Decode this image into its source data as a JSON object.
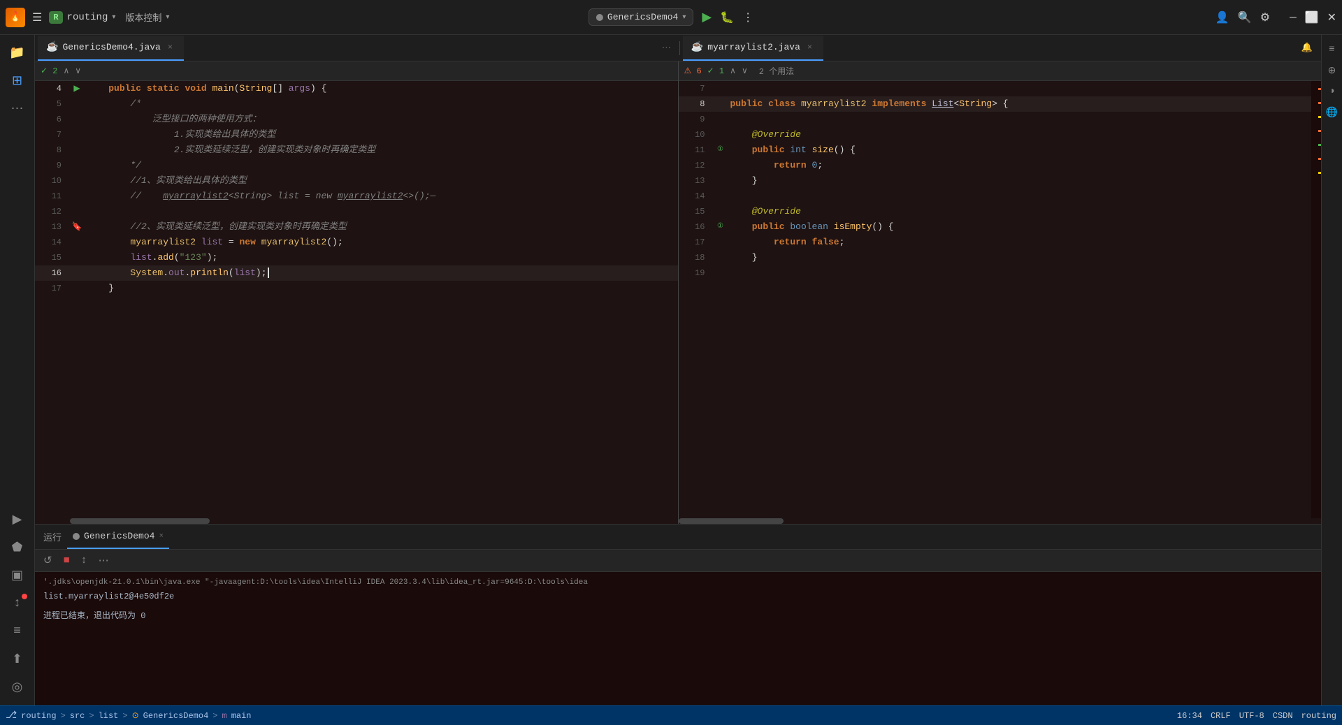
{
  "titleBar": {
    "projectLetter": "R",
    "projectName": "routing",
    "dropdownLabel": "▾",
    "versionControl": "版本控制",
    "versionControlArrow": "▾",
    "runConfig": "GenericsDemo4",
    "runConfigArrow": "▾"
  },
  "tabs": {
    "left": {
      "icon": "☕",
      "label": "GenericsDemo4.java",
      "closeBtn": "×",
      "moreBtn": "⋯"
    },
    "right": {
      "icon": "☕",
      "label": "myarraylist2.java",
      "closeBtn": "×",
      "notificationBtn": "🔔"
    }
  },
  "editorLeft": {
    "checkCount": "✓ 2",
    "navUp": "∧",
    "navDown": "∨",
    "lines": [
      {
        "num": "4",
        "gutter": "▶",
        "gutterType": "run",
        "content": "    public static void main(String[] args) {"
      },
      {
        "num": "5",
        "gutter": "",
        "content": "        /*"
      },
      {
        "num": "6",
        "gutter": "",
        "content": "            泛型接口的两种使用方式："
      },
      {
        "num": "7",
        "gutter": "",
        "content": "                1.实现类给出具体的类型"
      },
      {
        "num": "8",
        "gutter": "",
        "content": "                2.实现类延续泛型，创建实现类对象时再确定类型"
      },
      {
        "num": "9",
        "gutter": "",
        "content": "        */"
      },
      {
        "num": "10",
        "gutter": "",
        "content": "        //1、实现类给出具体的类型"
      },
      {
        "num": "11",
        "gutter": "",
        "content": "        //    myarraylist2<String> list = new myarraylist2<>();—"
      },
      {
        "num": "12",
        "gutter": "",
        "content": ""
      },
      {
        "num": "13",
        "gutter": "🔖",
        "gutterType": "bookmark",
        "content": "        //2、实现类延续泛型，创建实现类对象时再确定类型"
      },
      {
        "num": "14",
        "gutter": "",
        "content": "        myarraylist2 list = new myarraylist2();"
      },
      {
        "num": "15",
        "gutter": "",
        "content": "        list.add(\"123\");"
      },
      {
        "num": "16",
        "gutter": "",
        "content": "        System.out.println(list);",
        "active": true
      },
      {
        "num": "17",
        "gutter": "",
        "content": "    }"
      }
    ]
  },
  "editorRight": {
    "errorCount": "⚠ 6",
    "checkCount": "✓ 1",
    "navUp": "∧",
    "navDown": "∨",
    "usageHint": "2 个用法",
    "lines": [
      {
        "num": "7",
        "gutter": "",
        "content": ""
      },
      {
        "num": "8",
        "gutter": "",
        "content": "public class myarraylist2 implements List<String> {",
        "active": true
      },
      {
        "num": "9",
        "gutter": "",
        "content": ""
      },
      {
        "num": "10",
        "gutter": "",
        "content": "    @Override"
      },
      {
        "num": "11",
        "gutter": "①",
        "gutterType": "impl",
        "content": "    public int size() {"
      },
      {
        "num": "12",
        "gutter": "",
        "content": "        return 0;"
      },
      {
        "num": "13",
        "gutter": "",
        "content": "    }"
      },
      {
        "num": "14",
        "gutter": "",
        "content": ""
      },
      {
        "num": "15",
        "gutter": "",
        "content": "    @Override"
      },
      {
        "num": "16",
        "gutter": "①",
        "gutterType": "impl",
        "content": "    public boolean isEmpty() {"
      },
      {
        "num": "17",
        "gutter": "",
        "content": "        return false;"
      },
      {
        "num": "18",
        "gutter": "",
        "content": "    }"
      },
      {
        "num": "19",
        "gutter": "",
        "content": ""
      }
    ]
  },
  "runPanel": {
    "runLabel": "运行",
    "tabLabel": "GenericsDemo4",
    "tabClose": "×",
    "toolbar": {
      "restartBtn": "↺",
      "stopBtn": "■",
      "scrollBtn": "↕",
      "moreBtn": "⋯"
    },
    "cmdLine": "'.jdks\\openjdk-21.0.1\\bin\\java.exe \"-javaagent:D:\\tools\\idea\\IntelliJ IDEA 2023.3.4\\lib\\idea_rt.jar=9645:D:\\tools\\idea",
    "outputLine1": "list.myarraylist2@4e50df2e",
    "outputLine2": "",
    "exitLine": "进程已结束，退出代码为 0"
  },
  "statusBar": {
    "breadcrumbs": [
      {
        "label": "routing"
      },
      {
        "sep": " > "
      },
      {
        "label": "src"
      },
      {
        "sep": " > "
      },
      {
        "label": "list"
      },
      {
        "sep": " > "
      },
      {
        "label": "GenericsDemo4"
      },
      {
        "sep": " > "
      },
      {
        "label": "main"
      }
    ],
    "position": "16:34",
    "lineEnding": "CRLF",
    "encoding": "UTF-8",
    "indent": "CSDN",
    "context": "routing"
  }
}
